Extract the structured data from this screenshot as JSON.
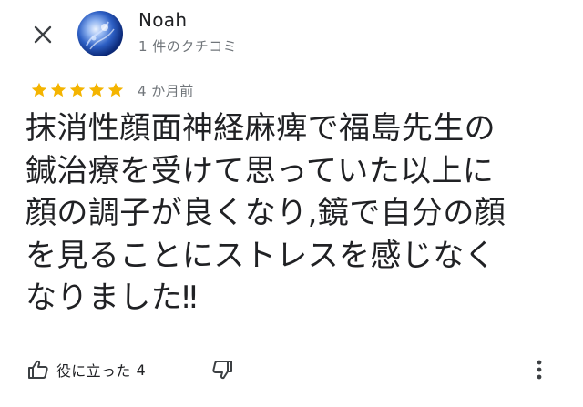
{
  "header": {
    "close_icon": "close-icon",
    "user": {
      "name": "Noah",
      "review_count": "1 件のクチコミ"
    }
  },
  "review": {
    "rating": 5,
    "rating_max": 5,
    "star_color": "#f4b400",
    "date": "4 か月前",
    "text": "抹消性顔面神経麻痺で福島先生の\n鍼治療を受けて思っていた以上に\n顔の調子が良くなり,鏡で自分の顔\nを見ることにストレスを感じなく\nなりました‼"
  },
  "actions": {
    "helpful_icon": "thumbs-up-icon",
    "helpful_label": "役に立った",
    "helpful_count": "4",
    "dislike_icon": "thumbs-down-icon",
    "more_icon": "more-vertical-icon"
  }
}
